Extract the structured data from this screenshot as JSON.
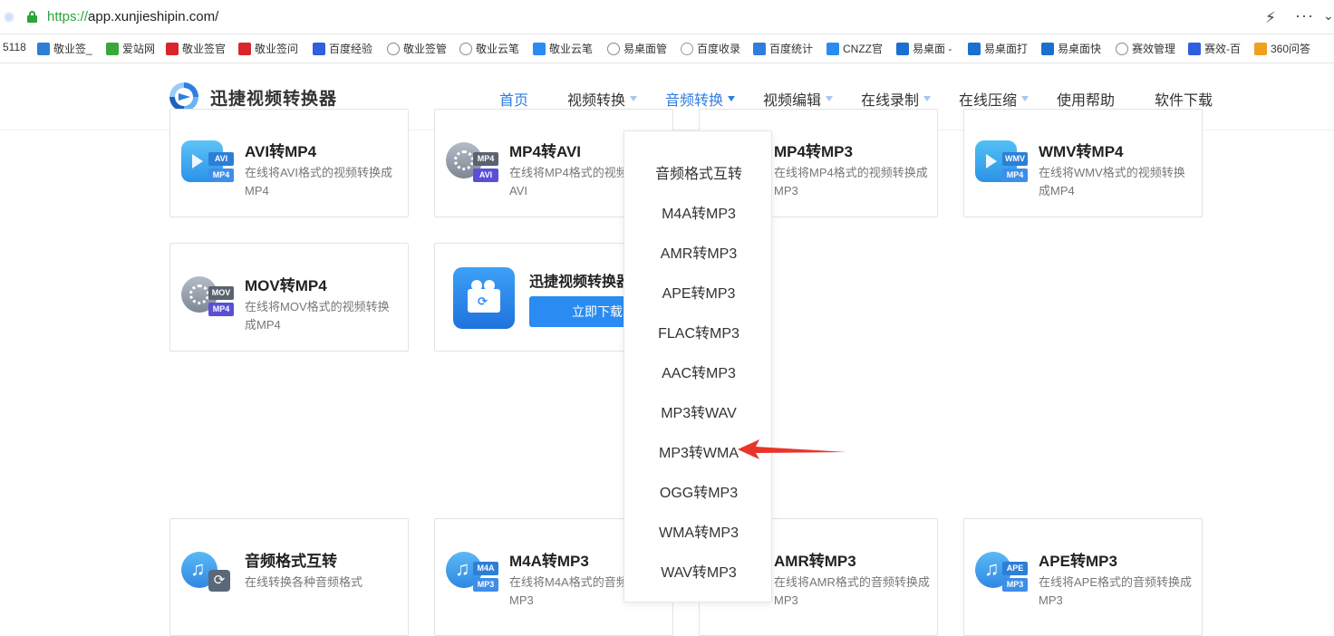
{
  "browser": {
    "url_scheme": "https://",
    "url_rest": "app.xunjieshipin.com/",
    "bookmarks": [
      {
        "label": "5118",
        "color": "#ffffff"
      },
      {
        "label": "敬业签_",
        "color": "#2d7fd6"
      },
      {
        "label": "爱站网",
        "color": "#38a838"
      },
      {
        "label": "敬业签官",
        "color": "#d8262a"
      },
      {
        "label": "敬业签问",
        "color": "#d8262a"
      },
      {
        "label": "百度经验",
        "color": "#2f5fe0"
      },
      {
        "label": "敬业签管",
        "color": "#888888"
      },
      {
        "label": "敬业云笔",
        "color": "#888888"
      },
      {
        "label": "敬业云笔",
        "color": "#2a8cf3"
      },
      {
        "label": "易桌面管",
        "color": "#888888"
      },
      {
        "label": "百度收录",
        "color": "#999999"
      },
      {
        "label": "百度统计",
        "color": "#2f7de1"
      },
      {
        "label": "CNZZ官",
        "color": "#2a8cf3"
      },
      {
        "label": "易桌面 -",
        "color": "#1a6fd0"
      },
      {
        "label": "易桌面打",
        "color": "#1a6fd0"
      },
      {
        "label": "易桌面快",
        "color": "#1a6fd0"
      },
      {
        "label": "赛效管理",
        "color": "#888888"
      },
      {
        "label": "赛效-百",
        "color": "#2f5fe0"
      },
      {
        "label": "360问答",
        "color": "#f0a020"
      }
    ]
  },
  "header": {
    "logo_text": "迅捷视频转换器",
    "nav": [
      {
        "label": "首页",
        "has_caret": false
      },
      {
        "label": "视频转换",
        "has_caret": true
      },
      {
        "label": "音频转换",
        "has_caret": true
      },
      {
        "label": "视频编辑",
        "has_caret": true
      },
      {
        "label": "在线录制",
        "has_caret": true
      },
      {
        "label": "在线压缩",
        "has_caret": true
      },
      {
        "label": "使用帮助",
        "has_caret": false
      },
      {
        "label": "软件下载",
        "has_caret": false
      }
    ]
  },
  "cards_row1": [
    {
      "title": "AVI转MP4",
      "desc": "在线将AVI格式的视频转换成MP4",
      "tag_top": "AVI",
      "tag_bottom": "MP4"
    },
    {
      "title": "MP4转AVI",
      "desc": "在线将MP4格式的视频转换成AVI",
      "tag_top": "MP4",
      "tag_bottom": "AVI"
    },
    {
      "title": "MP4转MP3",
      "desc": "在线将MP4格式的视频转换成MP3",
      "tag_top": "",
      "tag_bottom": ""
    },
    {
      "title": "WMV转MP4",
      "desc": "在线将WMV格式的视频转换成MP4",
      "tag_top": "WMV",
      "tag_bottom": "MP4"
    }
  ],
  "cards_row2": [
    {
      "title": "MOV转MP4",
      "desc": "在线将MOV格式的视频转换成MP4",
      "tag_top": "MOV",
      "tag_bottom": "MP4"
    }
  ],
  "promo": {
    "title": "迅捷视频转换器",
    "button": "立即下载"
  },
  "cards_row3": [
    {
      "title": "音频格式互转",
      "desc": "在线转换各种音频格式",
      "tag_top": "",
      "tag_bottom": ""
    },
    {
      "title": "M4A转MP3",
      "desc": "在线将M4A格式的音频转换成MP3",
      "tag_top": "M4A",
      "tag_bottom": "MP3"
    },
    {
      "title": "AMR转MP3",
      "desc": "在线将AMR格式的音频转换成MP3",
      "tag_top": "",
      "tag_bottom": ""
    },
    {
      "title": "APE转MP3",
      "desc": "在线将APE格式的音频转换成MP3",
      "tag_top": "APE",
      "tag_bottom": "MP3"
    }
  ],
  "dropdown": {
    "items": [
      "音频格式互转",
      "M4A转MP3",
      "AMR转MP3",
      "APE转MP3",
      "FLAC转MP3",
      "AAC转MP3",
      "MP3转WAV",
      "MP3转WMA",
      "OGG转MP3",
      "WMA转MP3",
      "WAV转MP3"
    ],
    "highlighted": "MP3转WMA"
  },
  "colors": {
    "brand_blue": "#2f7de1",
    "button_blue": "#2a8cf3",
    "arrow_red": "#e8352b"
  }
}
